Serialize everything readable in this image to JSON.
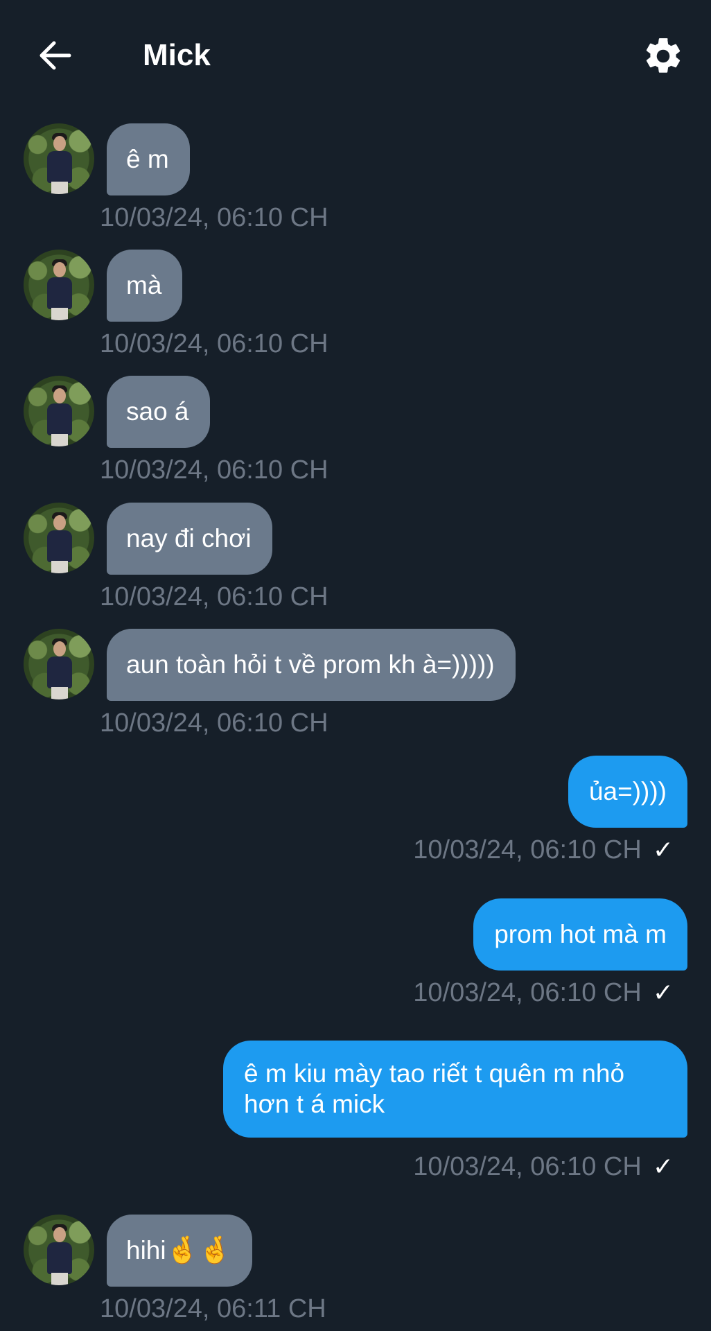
{
  "header": {
    "title": "Mick"
  },
  "icons": {
    "back": "arrow-left-icon",
    "settings": "gear-icon",
    "read": "check-icon"
  },
  "colors": {
    "background": "#161f29",
    "incoming_bubble": "#6b7a8c",
    "outgoing_bubble": "#1d9bf0",
    "timestamp": "#6d7785"
  },
  "messages": [
    {
      "direction": "in",
      "text": "ê m",
      "time": "10/03/24, 06:10 CH"
    },
    {
      "direction": "in",
      "text": "mà",
      "time": "10/03/24, 06:10 CH"
    },
    {
      "direction": "in",
      "text": "sao á",
      "time": "10/03/24, 06:10 CH"
    },
    {
      "direction": "in",
      "text": "nay đi chơi",
      "time": "10/03/24, 06:10 CH"
    },
    {
      "direction": "in",
      "text": "aun toàn hỏi t về prom kh à=)))))",
      "time": "10/03/24, 06:10 CH"
    },
    {
      "direction": "out",
      "text": "ủa=))))",
      "time": "10/03/24, 06:10 CH",
      "read": true
    },
    {
      "direction": "out",
      "text": "prom hot mà m",
      "time": "10/03/24, 06:10 CH",
      "read": true
    },
    {
      "direction": "out",
      "text": "ê m kiu mày tao riết t quên m nhỏ hơn t á mick",
      "time": "10/03/24, 06:10 CH",
      "read": true
    },
    {
      "direction": "in",
      "text": "hihi",
      "emoji": "🤞🤞",
      "time": "10/03/24, 06:11 CH"
    }
  ]
}
